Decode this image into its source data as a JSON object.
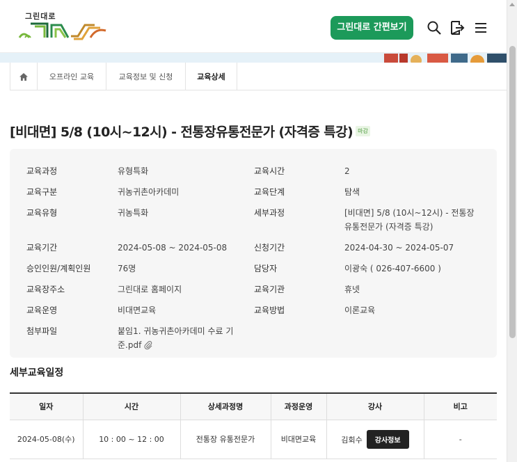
{
  "brand": {
    "logo_text": "그린대로"
  },
  "header": {
    "quick_view_label": "그린대로 간편보기",
    "icons": [
      "search-icon",
      "login-icon",
      "menu-icon"
    ]
  },
  "breadcrumb": {
    "items": [
      "오프라인 교육",
      "교육정보 및 신청",
      "교육상세"
    ]
  },
  "course": {
    "title": "[비대면] 5/8 (10시~12시) - 전통장유통전문가 (자격증 특강)",
    "status_badge": "마감"
  },
  "info": {
    "left": [
      {
        "label": "교육과정",
        "value": "유형특화"
      },
      {
        "label": "교육구분",
        "value": "귀농귀촌아카데미"
      },
      {
        "label": "교육유형",
        "value": "귀농특화"
      },
      {
        "label": "교육기간",
        "value": "2024-05-08 ~ 2024-05-08"
      },
      {
        "label": "승인인원/계획인원",
        "value": "76명"
      },
      {
        "label": "교육장주소",
        "value": "그린대로 홈페이지"
      },
      {
        "label": "교육운영",
        "value": "비대면교육"
      },
      {
        "label": "첨부파일",
        "value_line1": "붙임1. 귀농귀촌아카데미 수료 기",
        "value_line2": "준.pdf"
      }
    ],
    "right": [
      {
        "label": "교육시간",
        "value": "2"
      },
      {
        "label": "교육단계",
        "value": "탐색"
      },
      {
        "label": "세부과정",
        "value_line1": "[비대면] 5/8 (10시~12시) - 전통장",
        "value_line2": "유통전문가 (자격증 특강)"
      },
      {
        "label": "신청기간",
        "value": "2024-04-30 ~ 2024-05-07"
      },
      {
        "label": "담당자",
        "value": "이광숙 ( 026-407-6600 )"
      },
      {
        "label": "교육기관",
        "value": "휴넷"
      },
      {
        "label": "교육방법",
        "value": "이론교육"
      }
    ]
  },
  "schedule": {
    "title": "세부교육일정",
    "columns": [
      "일자",
      "시간",
      "상세과정명",
      "과정운영",
      "강사",
      "비고"
    ],
    "rows": [
      {
        "date": "2024-05-08(수)",
        "time": "10 : 00 ~ 12 : 00",
        "course": "전통장 유통전문가",
        "operation": "비대면교육",
        "teacher": "김회수",
        "teacher_button": "강사정보",
        "note": "-"
      }
    ]
  },
  "colors": {
    "accent_green": "#1c9a5a",
    "banner": "#e5f1f8"
  }
}
